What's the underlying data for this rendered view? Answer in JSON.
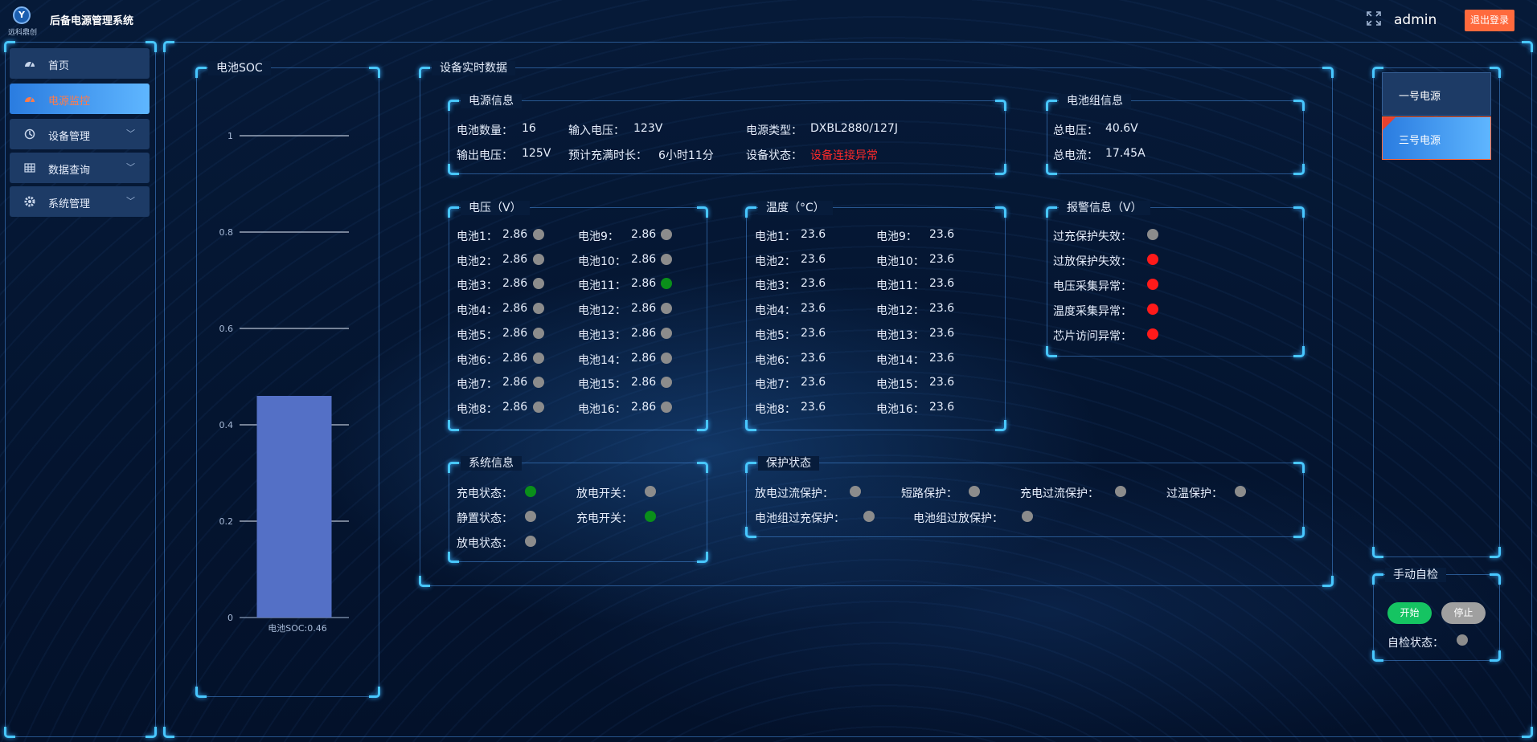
{
  "header": {
    "logo_text": "远科鼎创",
    "app_title": "后备电源管理系统",
    "username": "admin",
    "logout_label": "退出登录"
  },
  "sidebar": {
    "items": [
      {
        "label": "首页",
        "icon": "dashboard-icon",
        "has_submenu": false,
        "active": false
      },
      {
        "label": "电源监控",
        "icon": "gauge-icon",
        "has_submenu": false,
        "active": true
      },
      {
        "label": "设备管理",
        "icon": "device-icon",
        "has_submenu": true,
        "active": false
      },
      {
        "label": "数据查询",
        "icon": "table-icon",
        "has_submenu": true,
        "active": false
      },
      {
        "label": "系统管理",
        "icon": "gear-icon",
        "has_submenu": true,
        "active": false
      }
    ]
  },
  "soc_panel": {
    "title": "电池SOC",
    "bar_caption": "电池SOC:0.46"
  },
  "chart_data": {
    "type": "bar",
    "categories": [
      "电池SOC"
    ],
    "values": [
      0.46
    ],
    "ylim": [
      0,
      1
    ],
    "y_ticks": [
      "0",
      "0.2",
      "0.4",
      "0.6",
      "0.8",
      "1"
    ],
    "grid": true,
    "bar_color": "#5470c6"
  },
  "realtime": {
    "title": "设备实时数据",
    "power_info": {
      "title": "电源信息",
      "battery_count_label": "电池数量：",
      "battery_count": "16",
      "input_voltage_label": "输入电压：",
      "input_voltage": "123V",
      "power_type_label": "电源类型：",
      "power_type": "DXBL2880/127J",
      "output_voltage_label": "输出电压：",
      "output_voltage": "125V",
      "charge_time_label": "预计充满时长：",
      "charge_time": "6小时11分",
      "device_status_label": "设备状态：",
      "device_status": "设备连接异常"
    },
    "pack_info": {
      "title": "电池组信息",
      "total_voltage_label": "总电压：",
      "total_voltage": "40.6V",
      "total_current_label": "总电流：",
      "total_current": "17.45A"
    },
    "voltage": {
      "title": "电压（V）",
      "cells": [
        {
          "label": "电池1：",
          "value": "2.86",
          "status": "gray"
        },
        {
          "label": "电池2：",
          "value": "2.86",
          "status": "gray"
        },
        {
          "label": "电池3：",
          "value": "2.86",
          "status": "gray"
        },
        {
          "label": "电池4：",
          "value": "2.86",
          "status": "gray"
        },
        {
          "label": "电池5：",
          "value": "2.86",
          "status": "gray"
        },
        {
          "label": "电池6：",
          "value": "2.86",
          "status": "gray"
        },
        {
          "label": "电池7：",
          "value": "2.86",
          "status": "gray"
        },
        {
          "label": "电池8：",
          "value": "2.86",
          "status": "gray"
        },
        {
          "label": "电池9：",
          "value": "2.86",
          "status": "gray"
        },
        {
          "label": "电池10：",
          "value": "2.86",
          "status": "gray"
        },
        {
          "label": "电池11：",
          "value": "2.86",
          "status": "green"
        },
        {
          "label": "电池12：",
          "value": "2.86",
          "status": "gray"
        },
        {
          "label": "电池13：",
          "value": "2.86",
          "status": "gray"
        },
        {
          "label": "电池14：",
          "value": "2.86",
          "status": "gray"
        },
        {
          "label": "电池15：",
          "value": "2.86",
          "status": "gray"
        },
        {
          "label": "电池16：",
          "value": "2.86",
          "status": "gray"
        }
      ]
    },
    "temperature": {
      "title": "温度（°C）",
      "cells": [
        {
          "label": "电池1：",
          "value": "23.6"
        },
        {
          "label": "电池2：",
          "value": "23.6"
        },
        {
          "label": "电池3：",
          "value": "23.6"
        },
        {
          "label": "电池4：",
          "value": "23.6"
        },
        {
          "label": "电池5：",
          "value": "23.6"
        },
        {
          "label": "电池6：",
          "value": "23.6"
        },
        {
          "label": "电池7：",
          "value": "23.6"
        },
        {
          "label": "电池8：",
          "value": "23.6"
        },
        {
          "label": "电池9：",
          "value": "23.6"
        },
        {
          "label": "电池10：",
          "value": "23.6"
        },
        {
          "label": "电池11：",
          "value": "23.6"
        },
        {
          "label": "电池12：",
          "value": "23.6"
        },
        {
          "label": "电池13：",
          "value": "23.6"
        },
        {
          "label": "电池14：",
          "value": "23.6"
        },
        {
          "label": "电池15：",
          "value": "23.6"
        },
        {
          "label": "电池16：",
          "value": "23.6"
        }
      ]
    },
    "alarm": {
      "title": "报警信息（V）",
      "items": [
        {
          "label": "过充保护失效：",
          "status": "gray"
        },
        {
          "label": "过放保护失效：",
          "status": "red"
        },
        {
          "label": "电压采集异常：",
          "status": "red"
        },
        {
          "label": "温度采集异常：",
          "status": "red"
        },
        {
          "label": "芯片访问异常：",
          "status": "red"
        }
      ]
    },
    "system": {
      "title": "系统信息",
      "items": [
        {
          "label": "充电状态：",
          "status": "green"
        },
        {
          "label": "放电开关：",
          "status": "gray"
        },
        {
          "label": "静置状态：",
          "status": "gray"
        },
        {
          "label": "充电开关：",
          "status": "green"
        },
        {
          "label": "放电状态：",
          "status": "gray"
        }
      ]
    },
    "protection": {
      "title": "保护状态",
      "items": [
        {
          "label": "放电过流保护：",
          "status": "gray"
        },
        {
          "label": "短路保护：",
          "status": "gray"
        },
        {
          "label": "充电过流保护：",
          "status": "gray"
        },
        {
          "label": "过温保护：",
          "status": "gray"
        },
        {
          "label": "电池组过充保护：",
          "status": "gray"
        },
        {
          "label": "电池组过放保护：",
          "status": "gray"
        }
      ]
    }
  },
  "sources": {
    "items": [
      {
        "label": "一号电源",
        "selected": false
      },
      {
        "label": "三号电源",
        "selected": true
      }
    ]
  },
  "self_check": {
    "title": "手动自检",
    "start_label": "开始",
    "stop_label": "停止",
    "status_label": "自检状态：",
    "status": "gray"
  },
  "colors": {
    "accent": "#48c7ff",
    "logout": "#ff6a3d",
    "ok": "#0a8f1a",
    "alarm": "#ff1a1a",
    "idle": "#8c8c8c"
  }
}
